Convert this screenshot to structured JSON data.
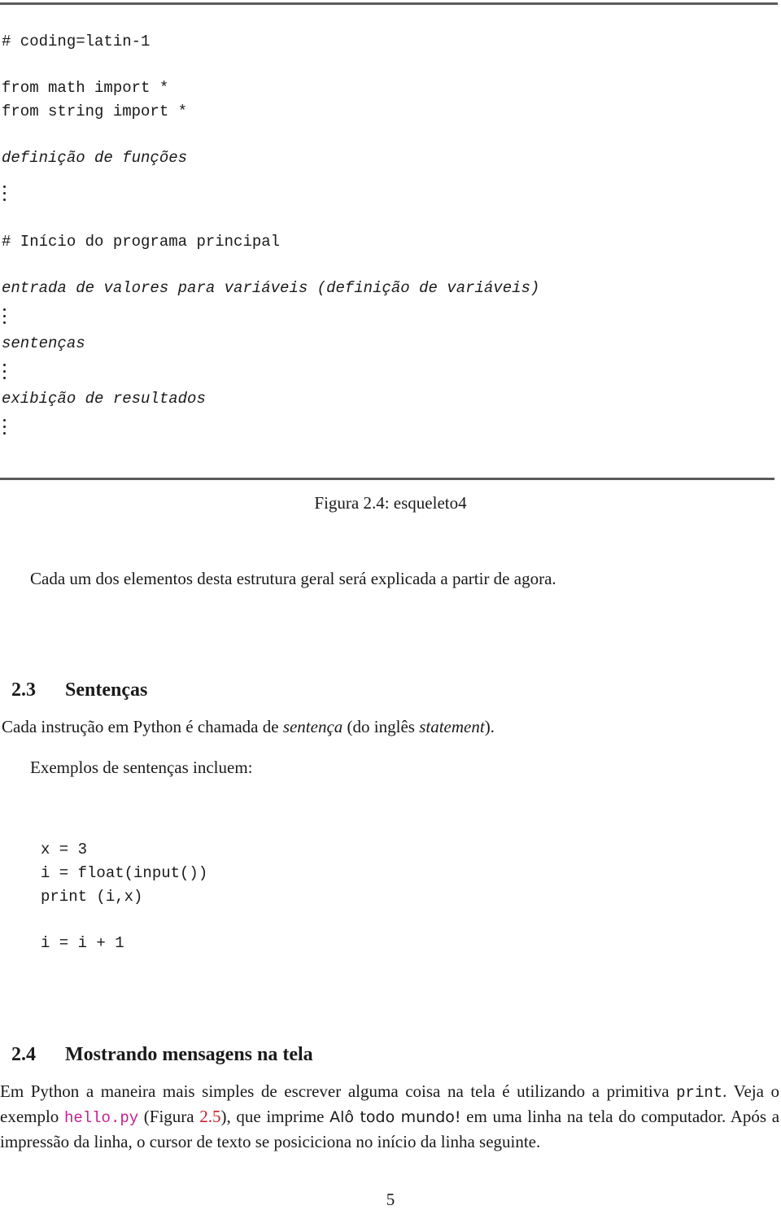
{
  "figure": {
    "code_lines": {
      "coding": "# coding=latin-1",
      "import_math": "from math import *",
      "import_string": "from string import *",
      "func_def": "definição de funções",
      "main_comment": "# Início do programa principal",
      "input_vars": "entrada de valores para variáveis (definição de variáveis)",
      "statements": "sentenças",
      "output": "exibição de resultados"
    },
    "caption": "Figura 2.4: esqueleto4"
  },
  "intro_paragraph": "Cada um dos elementos desta estrutura geral será explicada a partir de agora.",
  "section_2_3": {
    "number": "2.3",
    "title": "Sentenças",
    "para1_before": "Cada instrução em Python é chamada de ",
    "para1_em1": "sentença",
    "para1_mid": " (do inglês ",
    "para1_em2": "statement",
    "para1_after": ").",
    "para2": "Exemplos de sentenças incluem:",
    "examples": [
      "x = 3",
      "i = float(input())",
      "print (i,x)",
      "i = i + 1"
    ]
  },
  "section_2_4": {
    "number": "2.4",
    "title": "Mostrando mensagens na tela",
    "p_start": "Em Python a maneira mais simples de escrever alguma coisa na tela é utilizando a primitiva ",
    "p_code_print": "print",
    "p_after_print": ". Veja o exemplo ",
    "p_link_file": "hello.py",
    "p_fig_open": " (Figura ",
    "p_fig_ref": "2.5",
    "p_fig_close": "), que imprime ",
    "p_output_text": "Alô todo mundo!",
    "p_end": " em uma linha na tela do computador. Após a impressão da linha, o cursor de texto se posiciciona no início da linha seguinte."
  },
  "page_number": "5",
  "colors": {
    "link_code": "#c8208e",
    "figure_ref": "#c8202a",
    "rule": "#5a5a5a"
  }
}
